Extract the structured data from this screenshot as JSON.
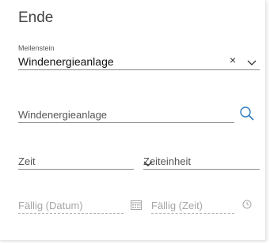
{
  "panel": {
    "title": "Ende"
  },
  "milestone": {
    "label": "Meilenstein",
    "value": "Windenergieanlage",
    "clear_symbol": "×"
  },
  "search_field": {
    "placeholder": "Windenergieanlage",
    "icon": "search-icon"
  },
  "time_field": {
    "placeholder": "Zeit"
  },
  "unit_field": {
    "placeholder": "Zeiteinheit"
  },
  "due_date_field": {
    "placeholder": "Fällig (Datum)",
    "icon": "calendar-icon"
  },
  "due_time_field": {
    "placeholder": "Fällig (Zeit)",
    "icon": "clock-icon"
  },
  "colors": {
    "accent": "#2b7bc0",
    "underline": "#8a8a8a",
    "disabled_text": "#a6a6a6"
  }
}
